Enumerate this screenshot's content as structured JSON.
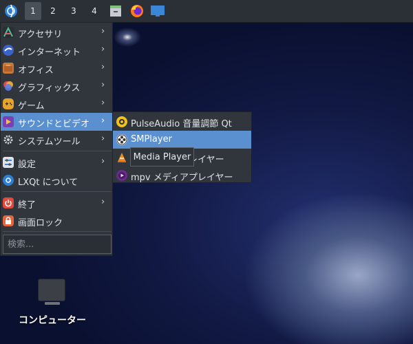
{
  "panel": {
    "desktops": [
      "1",
      "2",
      "3",
      "4"
    ],
    "active_desktop": "1",
    "quicklaunch_icons": [
      "file-manager-icon",
      "firefox-icon",
      "show-desktop-icon"
    ],
    "start_icon": "lxqt-logo-icon"
  },
  "menu": {
    "items": [
      {
        "label": "アクセサリ",
        "icon": "accessories-icon",
        "submenu": true
      },
      {
        "label": "インターネット",
        "icon": "internet-icon",
        "submenu": true
      },
      {
        "label": "オフィス",
        "icon": "office-icon",
        "submenu": true
      },
      {
        "label": "グラフィックス",
        "icon": "graphics-icon",
        "submenu": true
      },
      {
        "label": "ゲーム",
        "icon": "games-icon",
        "submenu": true
      },
      {
        "label": "サウンドとビデオ",
        "icon": "multimedia-icon",
        "submenu": true,
        "highlighted": true
      },
      {
        "label": "システムツール",
        "icon": "system-tools-icon",
        "submenu": true
      },
      {
        "label": "設定",
        "icon": "settings-icon",
        "submenu": true
      },
      {
        "label": "LXQt について",
        "icon": "lxqt-about-icon",
        "submenu": false
      },
      {
        "label": "終了",
        "icon": "power-icon",
        "submenu": true
      },
      {
        "label": "画面ロック",
        "icon": "lock-icon",
        "submenu": false
      }
    ],
    "search_placeholder": "検索..."
  },
  "submenu": {
    "items": [
      {
        "label": "PulseAudio 音量調節 Qt",
        "icon": "pulseaudio-icon"
      },
      {
        "label": "SMPlayer",
        "icon": "smplayer-icon",
        "highlighted": true
      },
      {
        "label": "VLC メディアプレイヤー",
        "visible_label": "レイヤー",
        "icon": "vlc-icon"
      },
      {
        "label": "mpv メディアプレイヤー",
        "icon": "mpv-icon"
      }
    ]
  },
  "tooltip": {
    "text": "Media Player"
  },
  "desktop": {
    "icon_label": "コンピューター",
    "icon": "computer-icon"
  },
  "colors": {
    "highlight": "#5a8fd0",
    "menu_bg": "#31363d",
    "panel_bg": "#2b3036"
  }
}
